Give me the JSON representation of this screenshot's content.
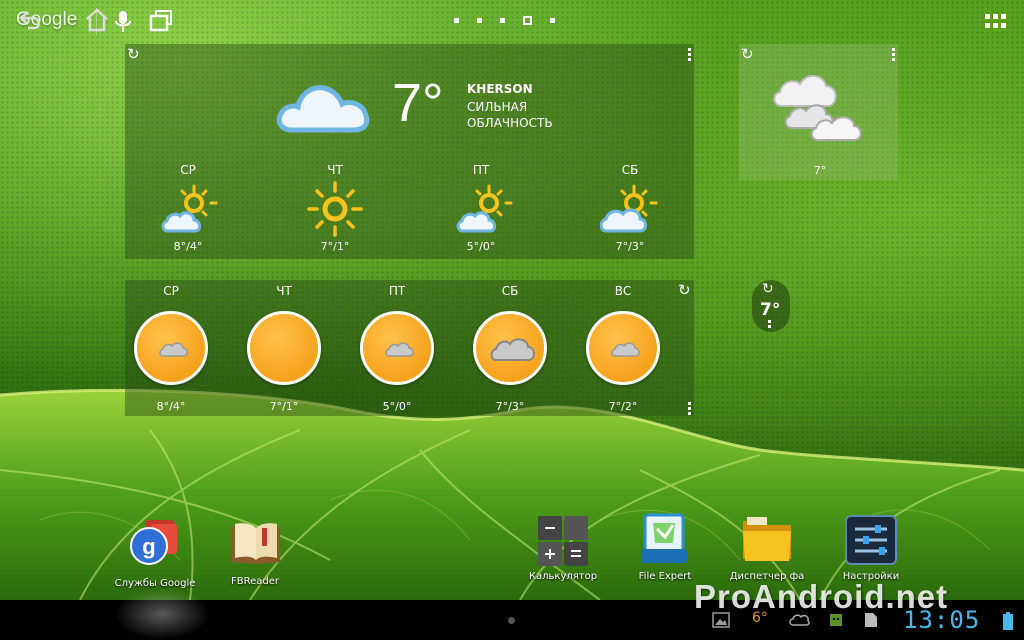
{
  "topbar": {
    "search_logo": "Google",
    "icons": [
      "mic-icon",
      "apps-grid-icon"
    ],
    "page_count": 5,
    "current_page": 4
  },
  "weather_main": {
    "current_temp": "7°",
    "city": "KHERSON",
    "condition": "СИЛЬНАЯ ОБЛАЧНОСТЬ",
    "forecast": [
      {
        "day": "СР",
        "temp": "8°/4°",
        "icon": "sun-cloud-icon"
      },
      {
        "day": "ЧТ",
        "temp": "7°/1°",
        "icon": "sun-icon"
      },
      {
        "day": "ПТ",
        "temp": "5°/0°",
        "icon": "sun-cloud-icon"
      },
      {
        "day": "СБ",
        "temp": "7°/3°",
        "icon": "sun-cloud-icon"
      }
    ]
  },
  "weather_circles": {
    "forecast": [
      {
        "day": "СР",
        "temp": "8°/4°",
        "icon": "cloud-on-sun-icon"
      },
      {
        "day": "ЧТ",
        "temp": "7°/1°",
        "icon": "sun-icon"
      },
      {
        "day": "ПТ",
        "temp": "5°/0°",
        "icon": "cloud-on-sun-icon"
      },
      {
        "day": "СБ",
        "temp": "7°/3°",
        "icon": "cloud-on-sun-icon"
      },
      {
        "day": "ВС",
        "temp": "7°/2°",
        "icon": "cloud-on-sun-icon"
      }
    ]
  },
  "weather_small": {
    "temp": "7°",
    "icon": "clouds-icon"
  },
  "weather_mini": {
    "temp": "7°"
  },
  "shortcuts": [
    {
      "label": "Службы Google",
      "icon": "google-services-icon"
    },
    {
      "label": "FBReader",
      "icon": "book-icon"
    },
    {
      "label": "Калькулятор",
      "icon": "calculator-icon"
    },
    {
      "label": "File Expert",
      "icon": "file-expert-icon"
    },
    {
      "label": "Диспетчер фа",
      "icon": "folder-icon"
    },
    {
      "label": "Настройки",
      "icon": "settings-icon"
    }
  ],
  "navbar": {
    "buttons": [
      "back-icon",
      "home-icon",
      "recent-apps-icon"
    ],
    "clock": "13:05",
    "watermark": "ProAndroid.net",
    "status_temp": "6°"
  },
  "colors": {
    "accent_orange": "#f6a21d",
    "clock_blue": "#49b8e8",
    "sun_yellow": "#f7c21a"
  }
}
